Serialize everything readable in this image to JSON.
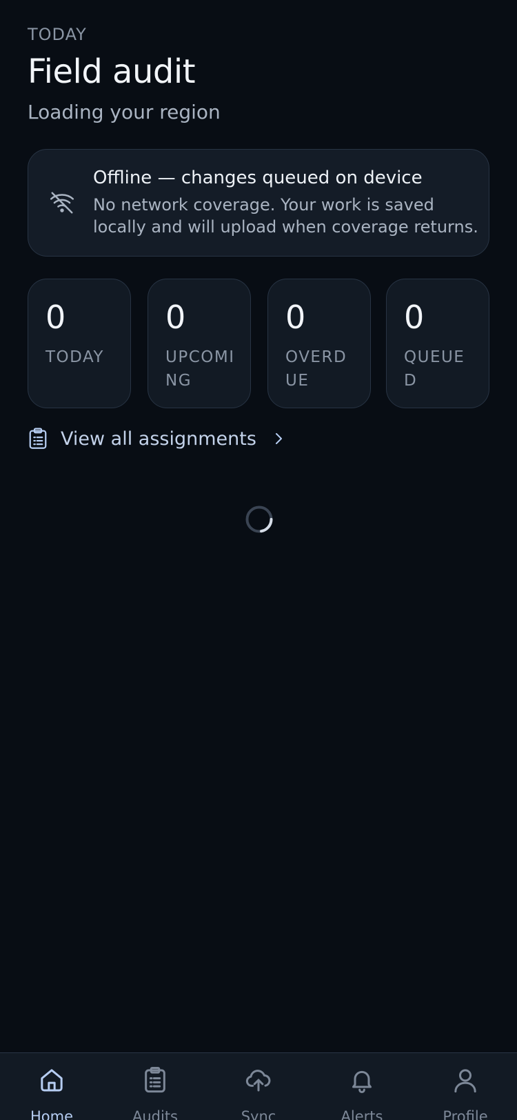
{
  "header": {
    "eyebrow": "TODAY",
    "title": "Field audit",
    "subtitle": "Loading your region"
  },
  "banner": {
    "icon": "wifi-off-icon",
    "title": "Offline — changes queued on device",
    "body": "No network coverage. Your work is saved locally and will upload when coverage returns."
  },
  "stats": [
    {
      "value": "0",
      "label": "TODAY"
    },
    {
      "value": "0",
      "label": "UPCOMING"
    },
    {
      "value": "0",
      "label": "OVERDUE"
    },
    {
      "value": "0",
      "label": "QUEUED"
    }
  ],
  "view_all": {
    "icon": "clipboard-list-icon",
    "label": "View all assignments",
    "chevron": "chevron-right-icon"
  },
  "loading": {
    "icon": "spinner-icon"
  },
  "tabbar": {
    "active": "Home",
    "tabs": [
      {
        "label": "Home",
        "icon": "home-icon"
      },
      {
        "label": "Audits",
        "icon": "clipboard-icon"
      },
      {
        "label": "Sync",
        "icon": "cloud-upload-icon"
      },
      {
        "label": "Alerts",
        "icon": "bell-icon"
      },
      {
        "label": "Profile",
        "icon": "user-icon"
      }
    ]
  },
  "colors": {
    "background": "#080d14",
    "surface": "#141c27",
    "border": "#283444",
    "accent": "#b6cdf2",
    "text_muted": "#8a95a4"
  }
}
